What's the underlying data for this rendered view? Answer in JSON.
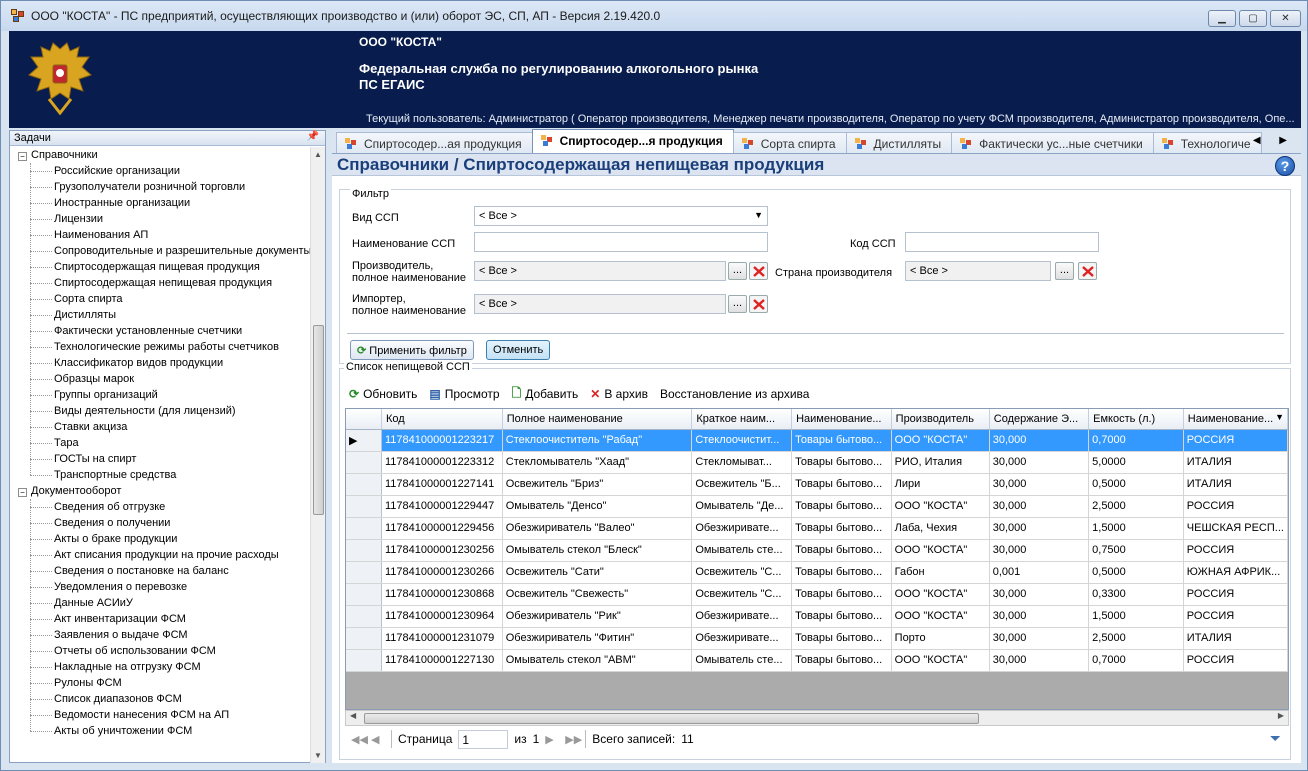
{
  "window": {
    "title": "ООО \"КОСТА\" - ПС предприятий, осуществляющих производство и (или) оборот ЭС, СП, АП - Версия 2.19.420.0",
    "buttons": {
      "minimize": "▁",
      "maximize": "▢",
      "close": "✕"
    }
  },
  "banner": {
    "org": "ООО \"КОСТА\"",
    "agency": "Федеральная служба по регулированию алкогольного рынка",
    "system": "ПС ЕГАИС",
    "user": "Текущий пользователь: Администратор ( Оператор производителя, Менеджер печати производителя, Оператор по учету ФСМ производителя, Администратор производителя, Опе..."
  },
  "tasks": {
    "title": "Задачи",
    "pin": "ᵖ",
    "groups": [
      {
        "label": "Справочники",
        "expander": "−",
        "items": [
          "Российские организации",
          "Грузополучатели розничной торговли",
          "Иностранные организации",
          "Лицензии",
          "Наименования АП",
          "Сопроводительные и разрешительные документы",
          "Спиртосодержащая пищевая продукция",
          "Спиртосодержащая непищевая продукция",
          "Сорта спирта",
          "Дистилляты",
          "Фактически установленные счетчики",
          "Технологические режимы работы счетчиков",
          "Классификатор видов продукции",
          "Образцы марок",
          "Группы организаций",
          "Виды деятельности (для лицензий)",
          "Ставки акциза",
          "Тара",
          "ГОСТы на спирт",
          "Транспортные средства"
        ]
      },
      {
        "label": "Документооборот",
        "expander": "−",
        "items": [
          "Сведения об отгрузке",
          "Сведения о получении",
          "Акты о браке продукции",
          "Акт списания продукции на прочие расходы",
          "Сведения о постановке на баланс",
          "Уведомления о перевозке",
          "Данные АСИиУ",
          "Акт инвентаризации ФСМ",
          "Заявления о выдаче ФСМ",
          "Отчеты об использовании ФСМ",
          "Накладные на отгрузку ФСМ",
          "Рулоны ФСМ",
          "Список диапазонов ФСМ",
          "Ведомости нанесения ФСМ на АП",
          "Акты об уничтожении ФСМ"
        ]
      }
    ]
  },
  "tabs": [
    {
      "label": "Спиртосодер...ая продукция",
      "active": false
    },
    {
      "label": "Спиртосодер...я продукция",
      "active": true
    },
    {
      "label": "Сорта спирта",
      "active": false
    },
    {
      "label": "Дистилляты",
      "active": false
    },
    {
      "label": "Фактически ус...ные счетчики",
      "active": false
    },
    {
      "label": "Технологиче",
      "active": false
    }
  ],
  "tab_nav": "◀ ▶",
  "page": {
    "title": "Справочники / Спиртосодержащая непищевая продукция",
    "help": "?"
  },
  "filter": {
    "legend": "Фильтр",
    "vid_label": "Вид ССП",
    "vid_value": "< Все >",
    "name_label": "Наименование ССП",
    "name_value": "",
    "code_label": "Код ССП",
    "code_value": "",
    "producer_label_1": "Производитель,",
    "producer_label_2": "полное наименование",
    "producer_value": "< Все >",
    "country_label": "Страна производителя",
    "country_value": "< Все >",
    "importer_label_1": "Импортер,",
    "importer_label_2": "полное наименование",
    "importer_value": "< Все >",
    "dots": "...",
    "apply": "Применить фильтр",
    "cancel": "Отменить"
  },
  "list": {
    "legend": "Список непищевой ССП",
    "toolbar": {
      "refresh": "Обновить",
      "view": "Просмотр",
      "add": "Добавить",
      "archive": "В архив",
      "restore": "Восстановление из архива"
    },
    "columns": [
      "Код",
      "Полное наименование",
      "Краткое наим...",
      "Наименование...",
      "Производитель",
      "Содержание Э...",
      "Емкость (л.)",
      "Наименование..."
    ],
    "rows": [
      [
        "117841000001223217",
        "Стеклоочиститель \"Рабад\"",
        "Стеклоочистит...",
        "Товары бытово...",
        "ООО \"КОСТА\"",
        "30,000",
        "0,7000",
        "РОССИЯ"
      ],
      [
        "117841000001223312",
        "Стекломыватель \"Хаад\"",
        "Стекломыват...",
        "Товары бытово...",
        "РИО, Италия",
        "30,000",
        "5,0000",
        "ИТАЛИЯ"
      ],
      [
        "117841000001227141",
        "Освежитель \"Бриз\"",
        "Освежитель \"Б...",
        "Товары бытово...",
        "Лири",
        "30,000",
        "0,5000",
        "ИТАЛИЯ"
      ],
      [
        "117841000001229447",
        "Омыватель \"Денсо\"",
        "Омыватель \"Де...",
        "Товары бытово...",
        "ООО \"КОСТА\"",
        "30,000",
        "2,5000",
        "РОССИЯ"
      ],
      [
        "117841000001229456",
        "Обезжириватель \"Валео\"",
        "Обезжиривате...",
        "Товары бытово...",
        "Лаба, Чехия",
        "30,000",
        "1,5000",
        "ЧЕШСКАЯ РЕСП..."
      ],
      [
        "117841000001230256",
        "Омыватель стекол \"Блеск\"",
        "Омыватель сте...",
        "Товары бытово...",
        "ООО \"КОСТА\"",
        "30,000",
        "0,7500",
        "РОССИЯ"
      ],
      [
        "117841000001230266",
        "Освежитель \"Сати\"",
        "Освежитель \"С...",
        "Товары бытово...",
        "Габон",
        "0,001",
        "0,5000",
        "ЮЖНАЯ АФРИК..."
      ],
      [
        "117841000001230868",
        "Освежитель \"Свежесть\"",
        "Освежитель \"С...",
        "Товары бытово...",
        "ООО \"КОСТА\"",
        "30,000",
        "0,3300",
        "РОССИЯ"
      ],
      [
        "117841000001230964",
        "Обезжириватель \"Рик\"",
        "Обезжиривате...",
        "Товары бытово...",
        "ООО \"КОСТА\"",
        "30,000",
        "1,5000",
        "РОССИЯ"
      ],
      [
        "117841000001231079",
        "Обезжириватель \"Фитин\"",
        "Обезжиривате...",
        "Товары бытово...",
        "Порто",
        "30,000",
        "2,5000",
        "ИТАЛИЯ"
      ],
      [
        "117841000001227130",
        "Омыватель стекол \"АВМ\"",
        "Омыватель сте...",
        "Товары бытово...",
        "ООО \"КОСТА\"",
        "30,000",
        "0,7000",
        "РОССИЯ"
      ]
    ],
    "selected_marker": "▶"
  },
  "pager": {
    "page_label": "Страница",
    "page_value": "1",
    "of_label": "из",
    "of_value": "1",
    "total_label": "Всего записей:",
    "total_value": "11",
    "nav": [
      "◀◀",
      "◀",
      "▶",
      "▶▶"
    ]
  }
}
